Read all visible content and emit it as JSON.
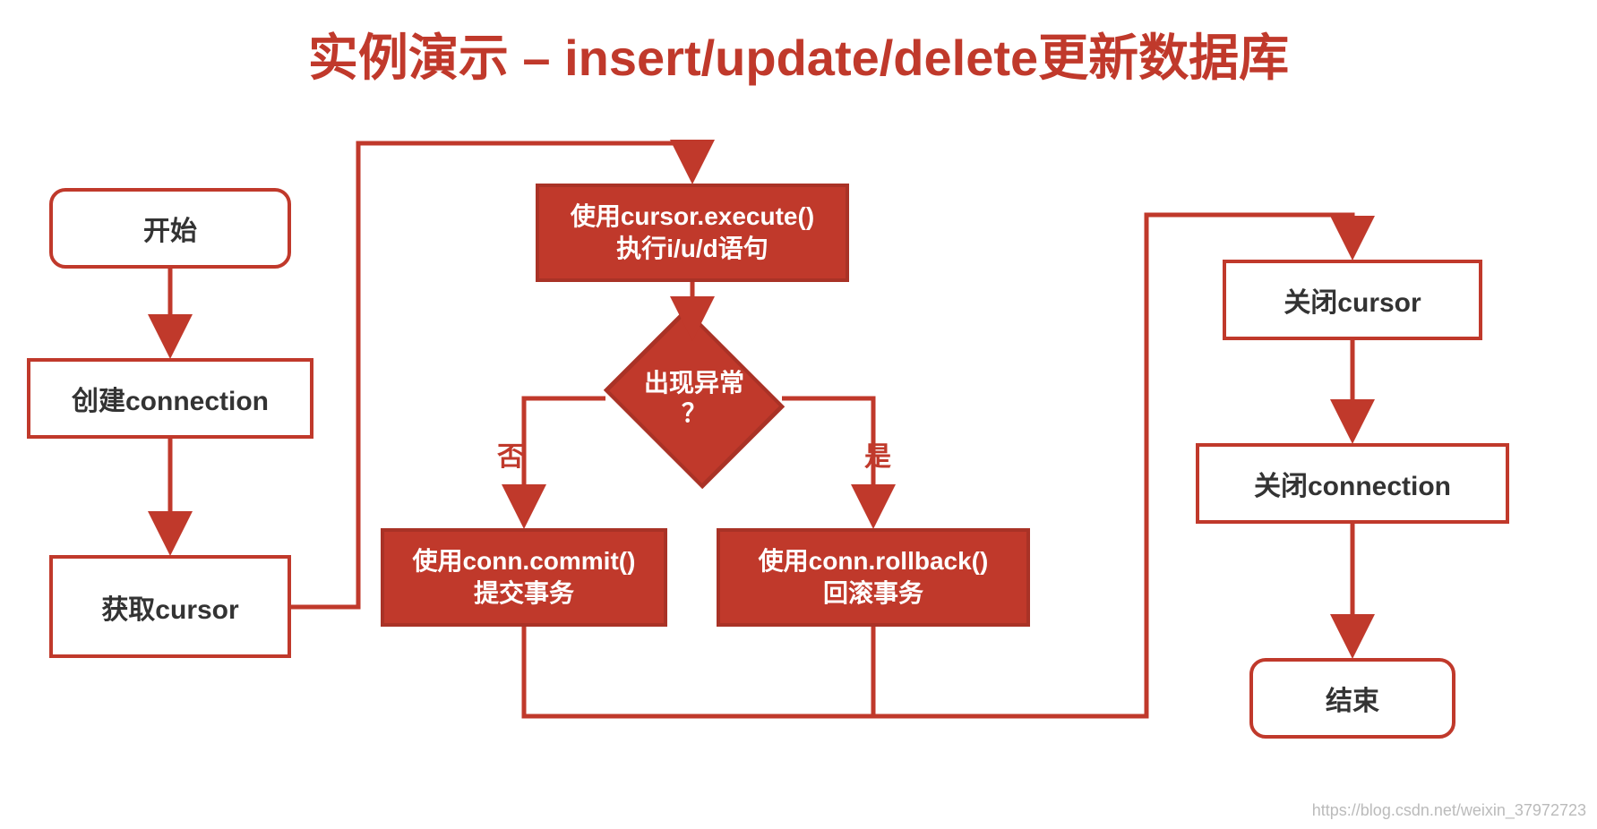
{
  "title": "实例演示 – insert/update/delete更新数据库",
  "nodes": {
    "start": "开始",
    "create_conn": "创建connection",
    "get_cursor": "获取cursor",
    "execute_line1": "使用cursor.execute()",
    "execute_line2": "执行i/u/d语句",
    "exception_line1": "出现异常",
    "exception_line2": "？",
    "branch_no": "否",
    "branch_yes": "是",
    "commit_line1": "使用conn.commit()",
    "commit_line2": "提交事务",
    "rollback_line1": "使用conn.rollback()",
    "rollback_line2": "回滚事务",
    "close_cursor": "关闭cursor",
    "close_conn": "关闭connection",
    "end": "结束"
  },
  "watermark": "https://blog.csdn.net/weixin_37972723"
}
